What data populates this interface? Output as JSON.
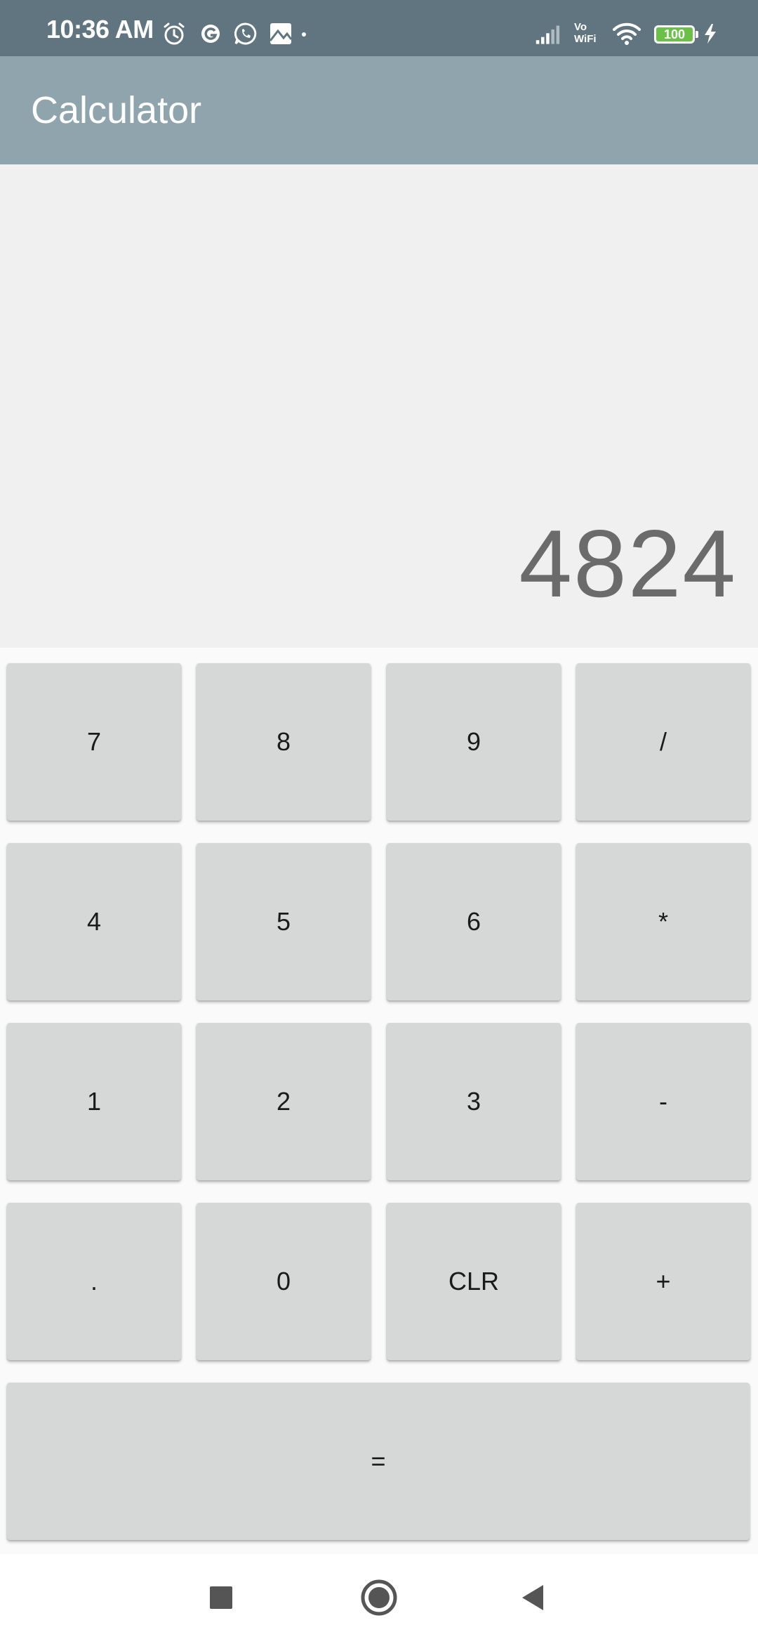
{
  "status_bar": {
    "time": "10:36 AM",
    "battery": "100",
    "vowifi_top": "Vo",
    "vowifi_bottom": "WiFi",
    "icons": [
      "alarm-icon",
      "g-app-icon",
      "whatsapp-icon",
      "photos-icon",
      "signal-icon",
      "wifi-icon",
      "battery-icon",
      "charging-icon"
    ]
  },
  "app_bar": {
    "title": "Calculator"
  },
  "display": {
    "value": "4824"
  },
  "keypad": {
    "keys": [
      "7",
      "8",
      "9",
      "/",
      "4",
      "5",
      "6",
      "*",
      "1",
      "2",
      "3",
      "-",
      ".",
      "0",
      "CLR",
      "+"
    ],
    "equals": "="
  },
  "colors": {
    "status_bar": "#607580",
    "app_bar": "#90a4ad",
    "key": "#d6d7d7",
    "display_text": "#6b6b6b"
  }
}
